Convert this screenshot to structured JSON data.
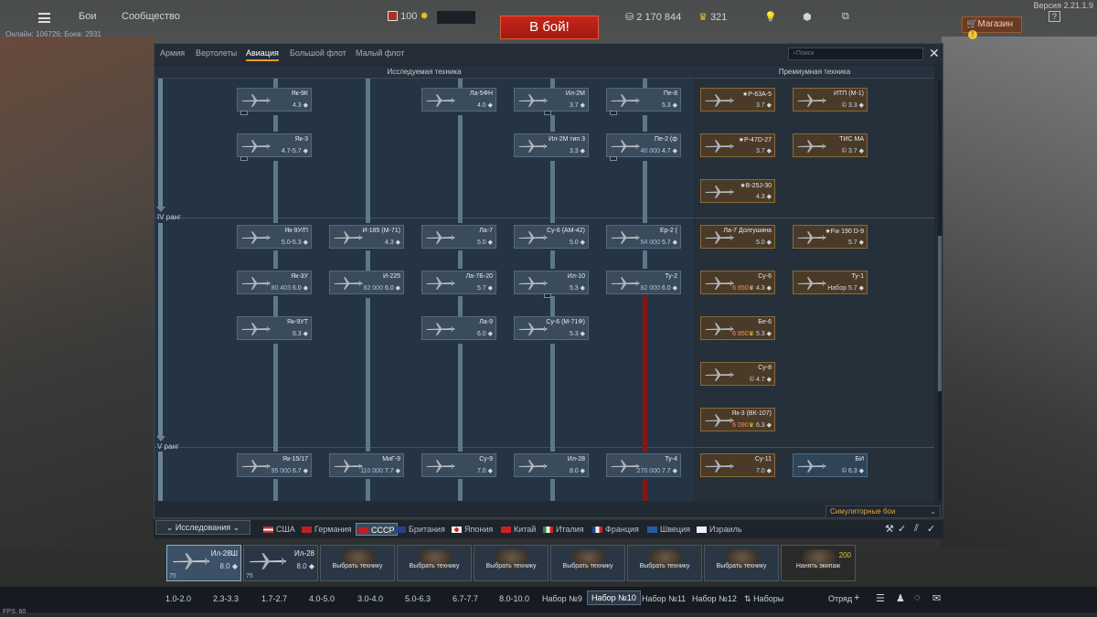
{
  "version": "Версия 2.21.1.9",
  "online": "Онлайн: 106726; Боев: 2931",
  "top": {
    "battles": "Бои",
    "community": "Сообщество",
    "rank_value": "100",
    "battle_btn": "В бой!",
    "silver": "2 170 844",
    "gold": "321",
    "shop": "Магазин",
    "shop_alert": "!"
  },
  "tabs": [
    "Армия",
    "Вертолеты",
    "Авиация",
    "Большой флот",
    "Малый флот"
  ],
  "active_tab": "Авиация",
  "search_placeholder": "Поиск",
  "sections": {
    "researched": "Исследуемая техника",
    "premium": "Премиумная техника"
  },
  "ranks": {
    "iv": "IV ранг",
    "v": "V ранг"
  },
  "tree_cards": [
    {
      "name": "Як-9К",
      "br": "4.3"
    },
    {
      "name": "Ла-5ФН",
      "br": "4.0"
    },
    {
      "name": "Ил-2М",
      "br": "3.7"
    },
    {
      "name": "Пе-8",
      "br": "5.3"
    },
    {
      "name": "Як-3",
      "br": "4.7-5.7"
    },
    {
      "name": "Ил-2М тип 3",
      "br": "3.3"
    },
    {
      "name": "Пе-2 (ф",
      "rp": "40 000",
      "br": "4.7"
    },
    {
      "name": "Як-9У/П",
      "br": "5.0-5.3"
    },
    {
      "name": "И-185 (М-71)",
      "br": "4.3"
    },
    {
      "name": "Ла-7",
      "br": "5.0"
    },
    {
      "name": "Су-6 (АМ-42)",
      "br": "5.0"
    },
    {
      "name": "Ер-2 (",
      "rp": "54 000",
      "br": "5.7"
    },
    {
      "name": "Як-3У",
      "rp": "80 403",
      "br": "6.0"
    },
    {
      "name": "И-225",
      "rp": "82 000",
      "br": "6.0"
    },
    {
      "name": "Ла-7Б-20",
      "br": "5.7"
    },
    {
      "name": "Ил-10",
      "br": "5.3"
    },
    {
      "name": "Ту-2",
      "rp": "82 000",
      "br": "6.0"
    },
    {
      "name": "Як-9УТ",
      "br": "6.3"
    },
    {
      "name": "Ла-9",
      "br": "6.0"
    },
    {
      "name": "Су-6 (М-71Ф)",
      "br": "5.3"
    },
    {
      "name": "Як-15/17",
      "rp": "95 000",
      "br": "6.7"
    },
    {
      "name": "МиГ-9",
      "rp": "110 000",
      "br": "7.7"
    },
    {
      "name": "Су-9",
      "rp": "",
      "br": "7.0"
    },
    {
      "name": "Ил-28",
      "br": "8.0"
    },
    {
      "name": "Ту-4",
      "rp": "270 000",
      "br": "7.7"
    }
  ],
  "prem_cards": [
    {
      "name": "★P-63A-5",
      "br": "3.7"
    },
    {
      "name": "ИТП (М-1)",
      "br": "3.3"
    },
    {
      "name": "★P-47D-27",
      "br": "3.7"
    },
    {
      "name": "ТИС МА",
      "br": "3.7"
    },
    {
      "name": "★B-25J-30",
      "br": "4.3"
    },
    {
      "name": "Ла-7 Долгушина",
      "br": "5.0"
    },
    {
      "name": "★Fw 190 D-9",
      "br": "5.7"
    },
    {
      "name": "Су-6",
      "price": "6 850",
      "br": "4.3"
    },
    {
      "name": "Ту-1",
      "price": "Набор",
      "br": "5.7"
    },
    {
      "name": "Бе-6",
      "price": "6 850",
      "br": "5.3"
    },
    {
      "name": "Су-8",
      "br": "4.7"
    },
    {
      "name": "Як-3 (ВК-107)",
      "price": "6 090",
      "br": "6.3"
    },
    {
      "name": "Су-11",
      "br": "7.0"
    },
    {
      "name": "БИ",
      "br": "6.3"
    }
  ],
  "game_mode": "Симуляторные бои",
  "research_tab": "Исследования",
  "nations": [
    "США",
    "Германия",
    "СССР",
    "Британия",
    "Япония",
    "Китай",
    "Италия",
    "Франция",
    "Швеция",
    "Израиль"
  ],
  "active_nation": "СССР",
  "crew": [
    {
      "name": "Ил-28Ш",
      "br": "8.0",
      "lv": "75"
    },
    {
      "name": "Ил-28",
      "br": "8.0",
      "lv": "75"
    },
    {
      "label": "Выбрать технику"
    },
    {
      "label": "Выбрать технику"
    },
    {
      "label": "Выбрать технику"
    },
    {
      "label": "Выбрать технику"
    },
    {
      "label": "Выбрать технику"
    },
    {
      "label": "Выбрать технику"
    },
    {
      "label": "Нанять экипаж",
      "price": "200"
    }
  ],
  "presets": [
    "1.0-2.0",
    "2.3-3.3",
    "1.7-2.7",
    "4.0-5.0",
    "3.0-4.0",
    "5.0-6.3",
    "6.7-7.7",
    "8.0-10.0",
    "Набор №9",
    "Набор №10",
    "Набор №11",
    "Набор №12",
    "Наборы"
  ],
  "active_preset": "Набор №10",
  "squad": "Отряд",
  "fps": "FPS: 60",
  "colors": {
    "accent": "#e89a2a",
    "battle": "#b8211a",
    "tree_bg": "#253444",
    "premium_bg": "#26303a"
  }
}
